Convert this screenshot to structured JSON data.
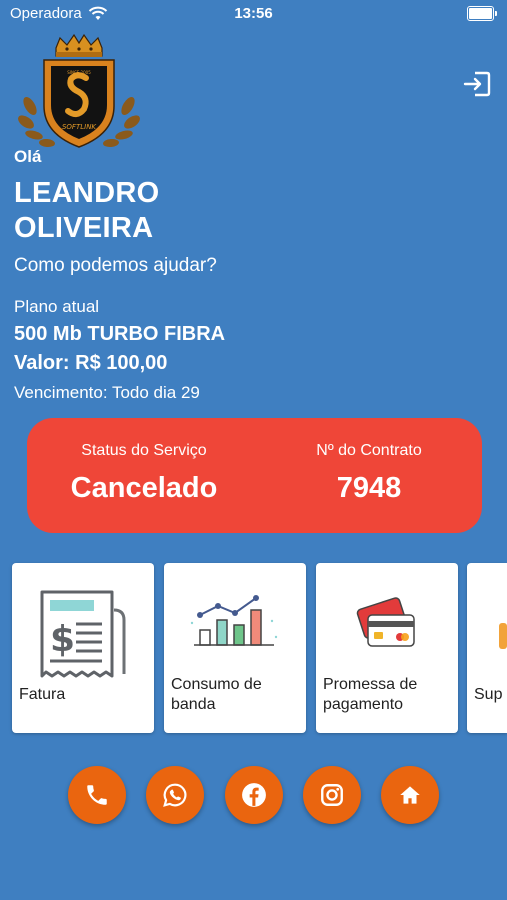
{
  "status_bar": {
    "carrier": "Operadora",
    "time": "13:56"
  },
  "logo": {
    "text": "SOFTLINK",
    "alt_text": "Softlink"
  },
  "user": {
    "greeting": "Olá",
    "first_name": "LEANDRO",
    "last_name": "OLIVEIRA",
    "help_text": "Como podemos ajudar?"
  },
  "plan": {
    "label": "Plano atual",
    "name": "500 Mb TURBO FIBRA",
    "value": "Valor: R$ 100,00",
    "due": "Vencimento: Todo dia 29"
  },
  "service": {
    "status_label": "Status do Serviço",
    "status_value": "Cancelado",
    "contract_label": "Nº do Contrato",
    "contract_value": "7948",
    "card_color": "#ef4638"
  },
  "menu": [
    {
      "label": "Fatura",
      "icon": "invoice-icon"
    },
    {
      "label_line1": "Consumo de",
      "label_line2": "banda",
      "icon": "bandwidth-chart-icon"
    },
    {
      "label_line1": "Promessa de",
      "label_line2": "pagamento",
      "icon": "credit-cards-icon"
    },
    {
      "label": "Sup",
      "icon": "support-icon"
    }
  ],
  "social": [
    {
      "icon": "phone-icon"
    },
    {
      "icon": "whatsapp-icon"
    },
    {
      "icon": "facebook-icon"
    },
    {
      "icon": "instagram-icon"
    },
    {
      "icon": "home-icon"
    }
  ],
  "colors": {
    "background": "#3f7fc1",
    "accent": "#ea650f",
    "status_card": "#ef4638"
  }
}
